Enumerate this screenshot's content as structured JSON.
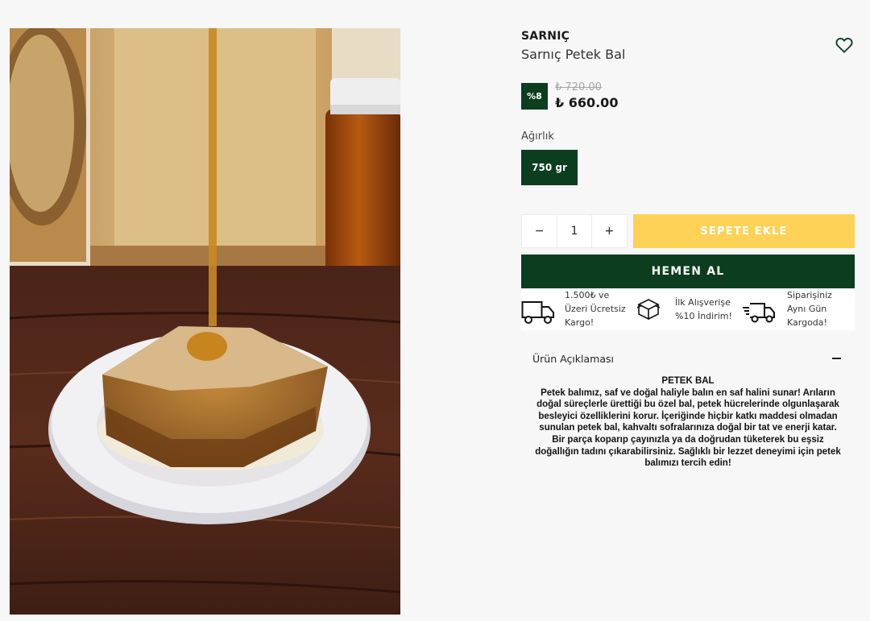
{
  "product": {
    "brand": "SARNIÇ",
    "name": "Sarnıç Petek Bal",
    "discount_badge": "%8",
    "old_price": "₺ 720.00",
    "price": "₺ 660.00"
  },
  "weight": {
    "label": "Ağırlık",
    "selected": "750 gr"
  },
  "cart": {
    "minus": "−",
    "quantity": "1",
    "plus": "+",
    "add_to_cart": "SEPETE EKLE",
    "buy_now": "HEMEN AL"
  },
  "features": [
    {
      "icon": "truck-icon",
      "lines": [
        "1.500₺ ve",
        "Üzeri Ücretsiz",
        "Kargo!"
      ]
    },
    {
      "icon": "box-icon",
      "lines": [
        "İlk Alışverişe",
        "%10 İndirim!"
      ]
    },
    {
      "icon": "fast-delivery-icon",
      "lines": [
        "Siparişiniz",
        "Aynı Gün",
        "Kargoda!"
      ]
    }
  ],
  "description": {
    "accordion_label": "Ürün Açıklaması",
    "title": "PETEK BAL",
    "lines": [
      "Petek balımız, saf ve doğal haliyle balın en saf halini sunar! Arıların",
      "doğal süreçlerle ürettiği bu özel bal, petek hücrelerinde olgunlaşarak",
      "besleyici özelliklerini korur. İçeriğinde hiçbir katkı maddesi olmadan",
      "sunulan petek bal, kahvaltı sofralarınıza doğal bir tat ve enerji katar.",
      "Bir parça koparıp çayınızla ya da doğrudan tüketerek bu eşsiz",
      "doğallığın tadını çıkarabilirsiniz. Sağlıklı bir lezzet deneyimi için petek",
      "balımızı tercih edin!"
    ]
  },
  "colors": {
    "brand_green": "#0b3d1e",
    "cart_yellow": "#fdd256",
    "background": "#f7f7f7"
  }
}
